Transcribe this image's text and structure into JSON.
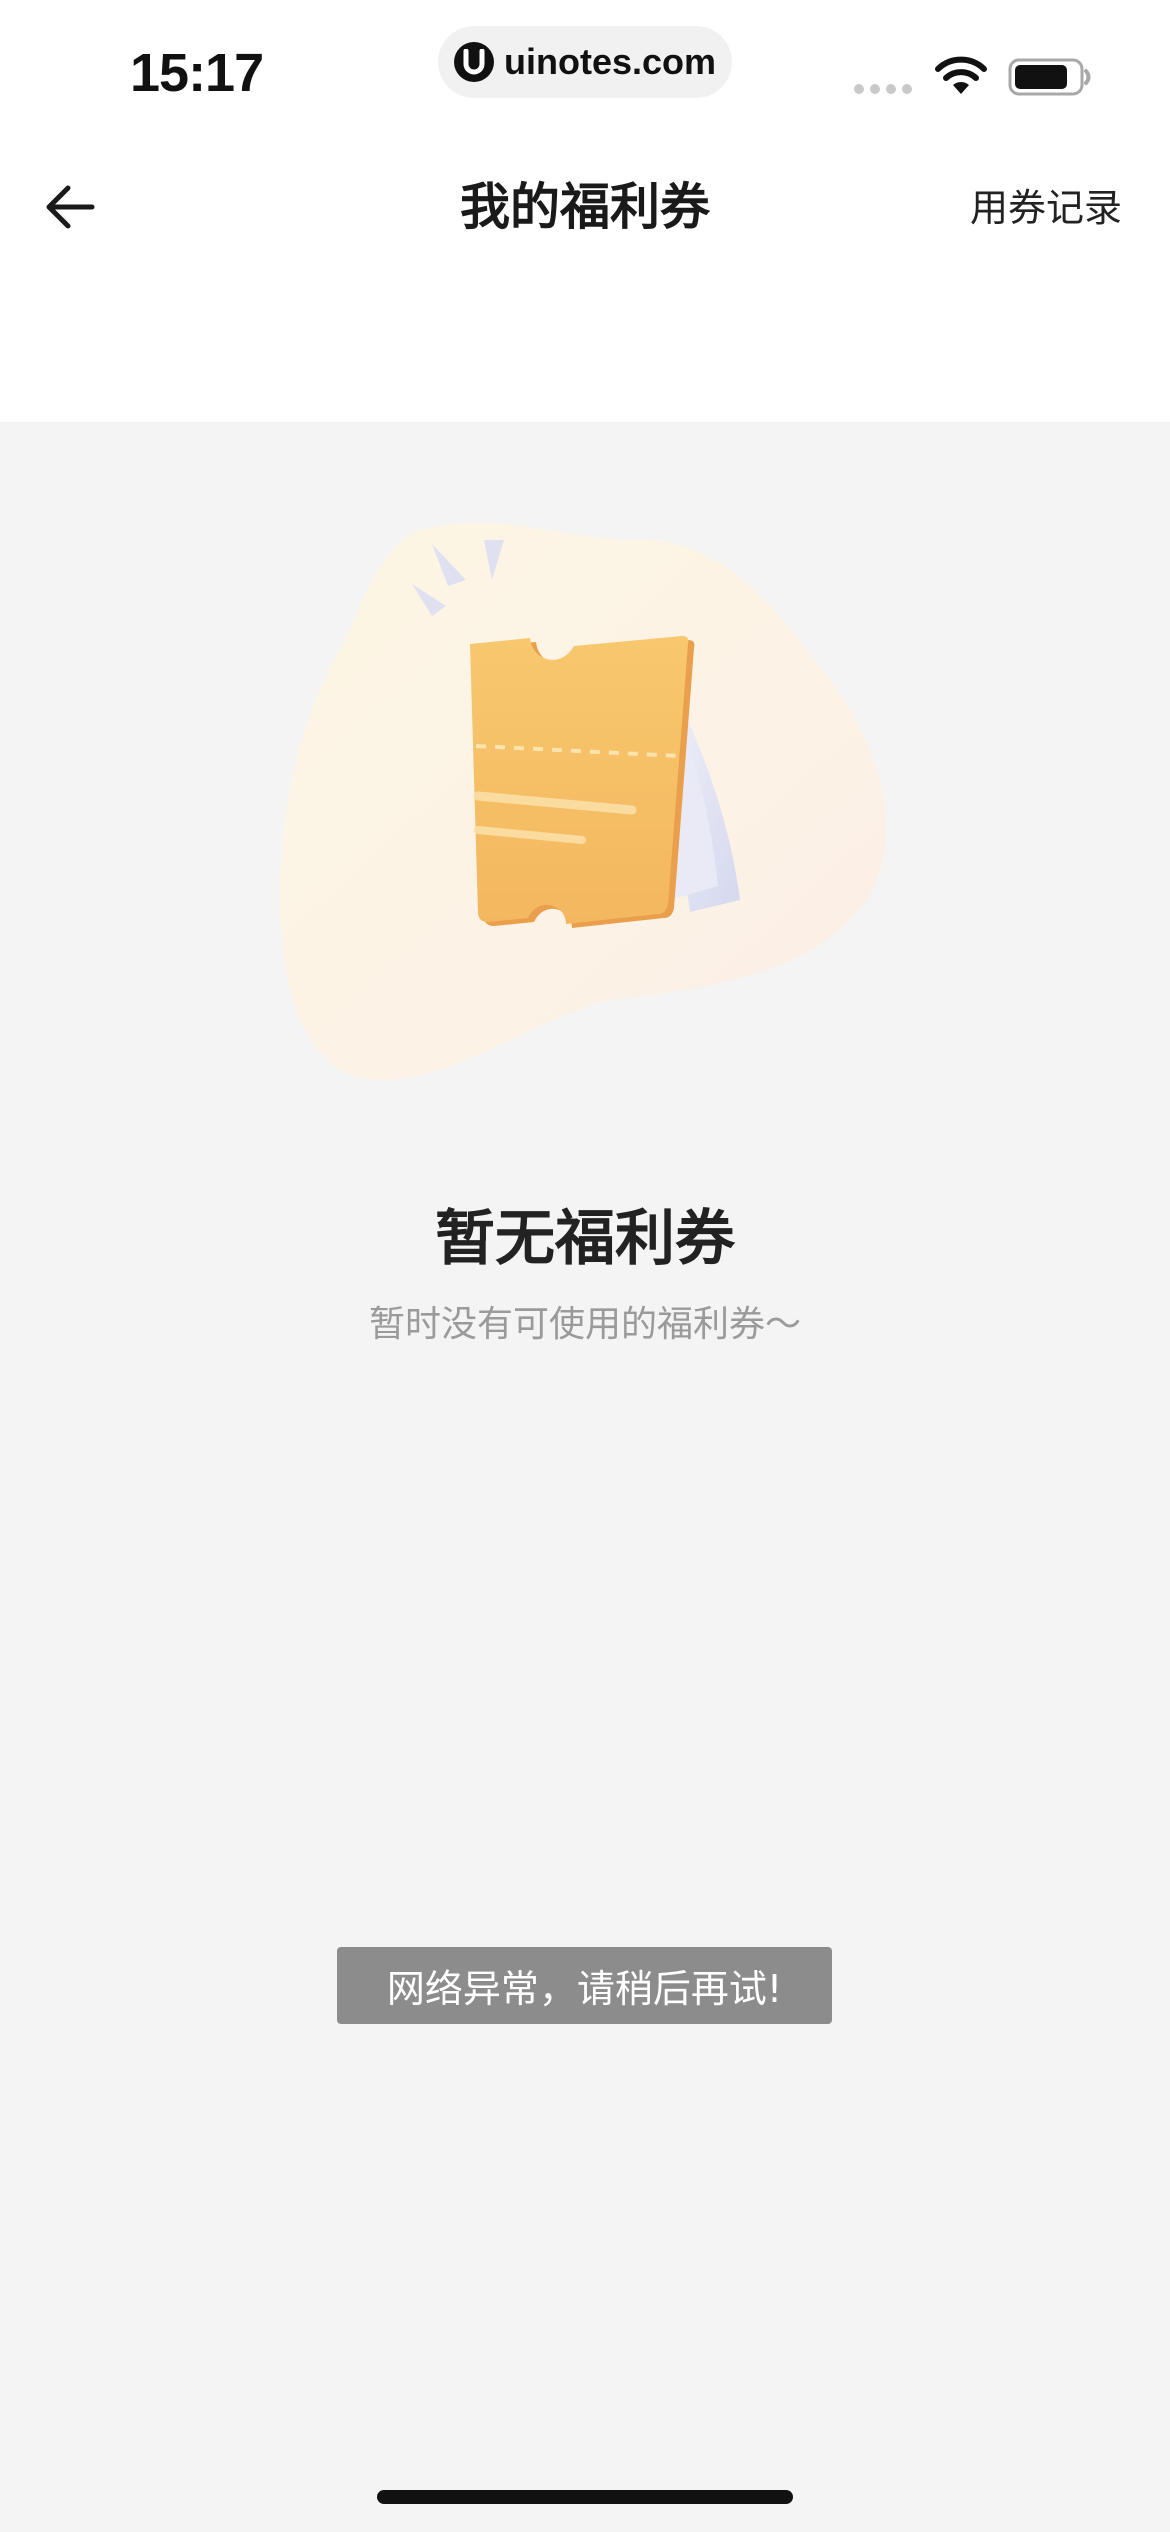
{
  "status_bar": {
    "time": "15:17",
    "url": "uinotes.com",
    "url_logo_letter": "U",
    "icons": [
      "signal-dots-icon",
      "wifi-icon",
      "battery-icon"
    ]
  },
  "nav": {
    "back_icon": "arrow-left-icon",
    "title": "我的福利券",
    "records_label": "用券记录"
  },
  "empty_state": {
    "illustration": "coupon-ticket-illustration",
    "title": "暂无福利券",
    "subtitle": "暂时没有可使用的福利券～"
  },
  "toast": {
    "message": "网络异常，请稍后再试!"
  },
  "colors": {
    "page_background": "#f4f4f4",
    "header_background": "#ffffff",
    "coupon_orange": "#f6bf62",
    "toast_background": "#8c8c8c",
    "subtitle_gray": "#9a9a9a"
  }
}
